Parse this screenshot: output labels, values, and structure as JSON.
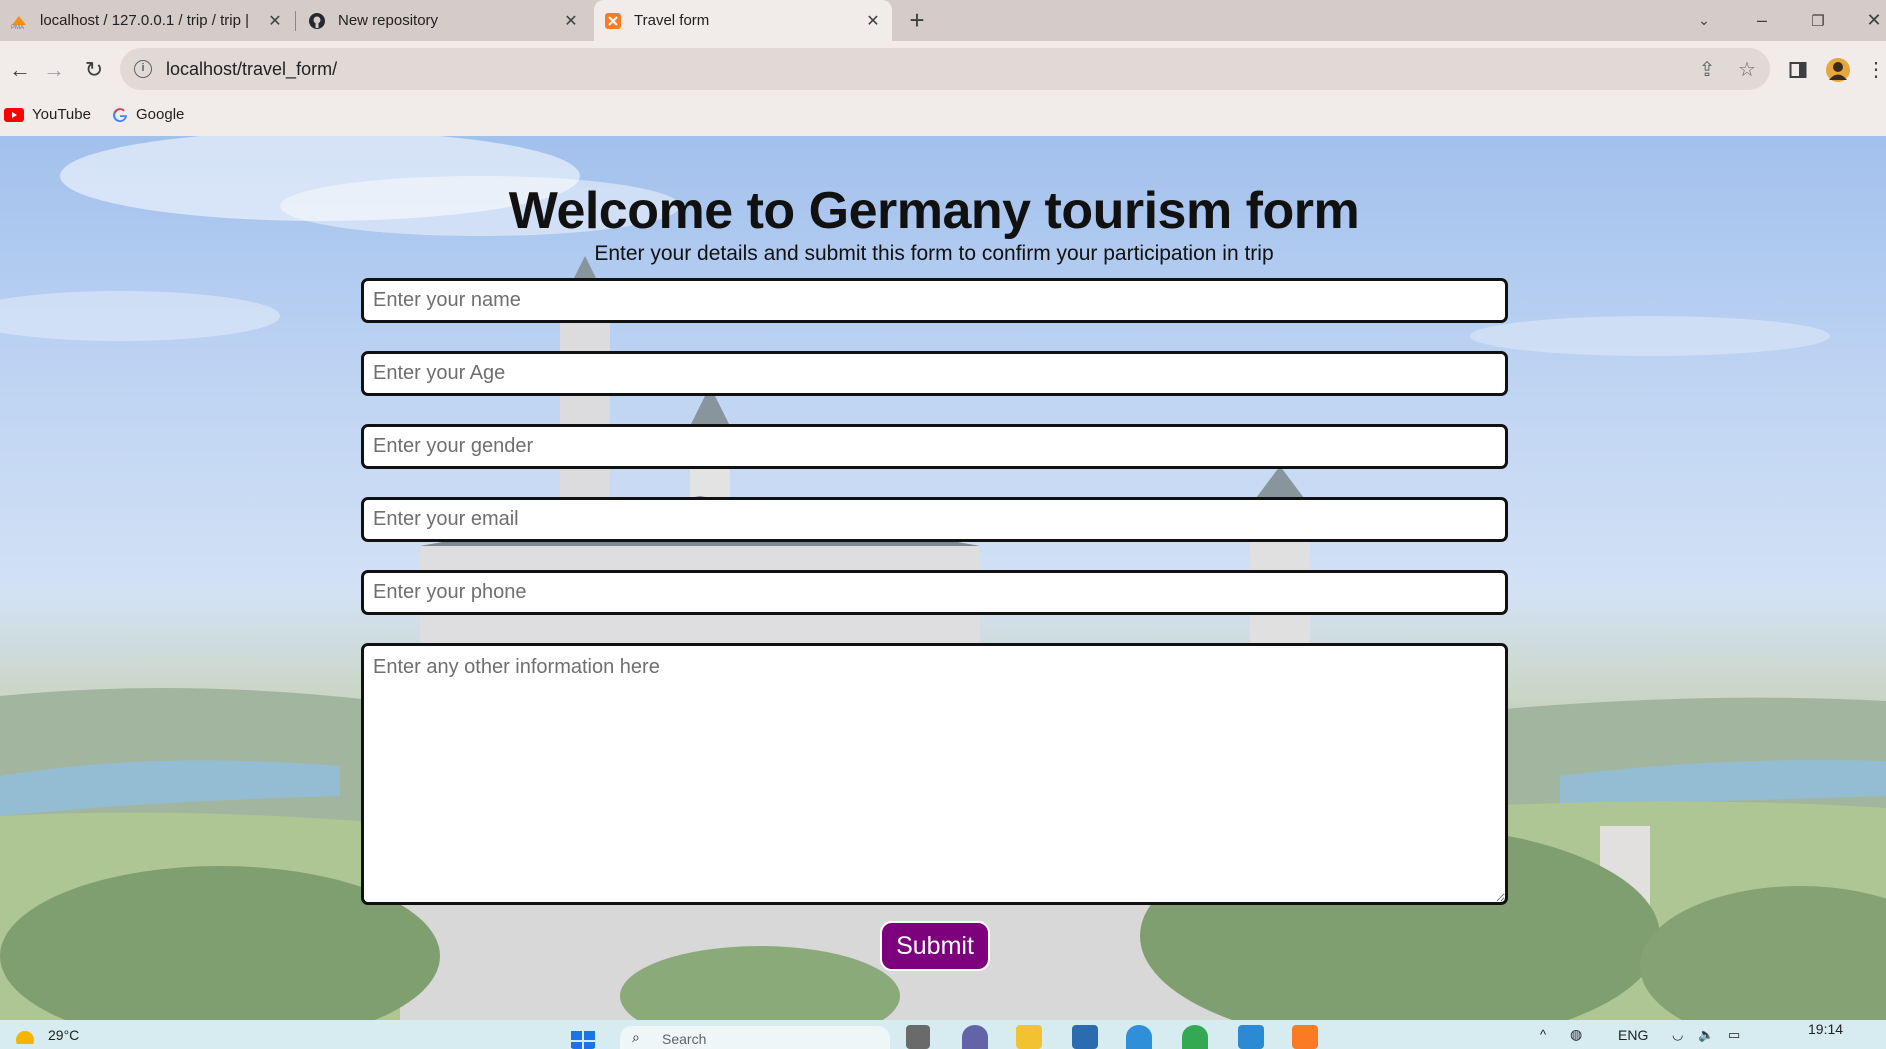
{
  "browser": {
    "tabs": [
      {
        "title": "localhost / 127.0.0.1 / trip / trip |",
        "icon": "phpmyadmin-icon"
      },
      {
        "title": "New repository",
        "icon": "github-icon"
      },
      {
        "title": "Travel form",
        "icon": "xampp-icon"
      }
    ],
    "address": "localhost/travel_form/",
    "bookmarks": [
      "YouTube",
      "Google"
    ]
  },
  "form": {
    "heading": "Welcome to Germany tourism form",
    "subheading": "Enter your details and submit this form to confirm your participation in trip",
    "placeholders": {
      "name": "Enter your name",
      "age": "Enter your Age",
      "gender": "Enter your gender",
      "email": "Enter your email",
      "phone": "Enter your phone",
      "other": "Enter any other information here"
    },
    "submit_label": "Submit"
  },
  "taskbar": {
    "weather": "29°C",
    "search": "Search",
    "language": "ENG",
    "time": "19:14"
  },
  "colors": {
    "submit_bg": "#7d007d",
    "tab_strip": "#d5cbc8",
    "toolbar": "#f1ecea",
    "taskbar": "#d6ecf0"
  }
}
